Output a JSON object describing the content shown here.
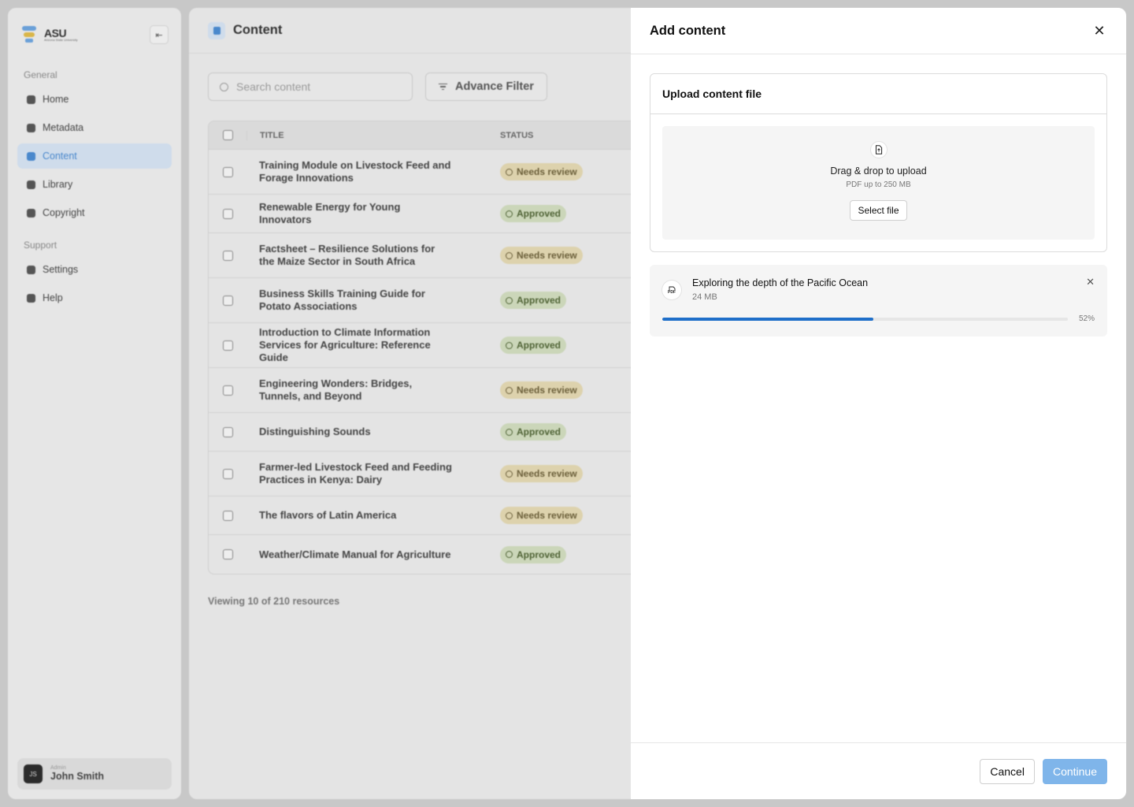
{
  "sidebar": {
    "logo_text": "ASU",
    "logo_subtext": "Arizona State University",
    "sections": [
      {
        "heading": "General",
        "items": [
          {
            "label": "Home",
            "icon": "home-icon"
          },
          {
            "label": "Metadata",
            "icon": "tag-icon"
          },
          {
            "label": "Content",
            "icon": "content-icon",
            "active": true
          },
          {
            "label": "Library",
            "icon": "library-icon"
          },
          {
            "label": "Copyright",
            "icon": "copyright-icon"
          }
        ]
      },
      {
        "heading": "Support",
        "items": [
          {
            "label": "Settings",
            "icon": "gear-icon"
          },
          {
            "label": "Help",
            "icon": "help-icon"
          }
        ]
      }
    ],
    "user": {
      "initials": "JS",
      "role": "Admin",
      "name": "John Smith"
    }
  },
  "main": {
    "title": "Content",
    "search_placeholder": "Search content",
    "filter_label": "Advance Filter",
    "columns": {
      "title": "TITLE",
      "status": "STATUS"
    },
    "rows": [
      {
        "title": "Training Module on Livestock Feed and Forage Innovations",
        "status": "Needs review"
      },
      {
        "title": "Renewable Energy for Young Innovators",
        "status": "Approved"
      },
      {
        "title": "Factsheet – Resilience Solutions for the Maize Sector in South Africa",
        "status": "Needs review"
      },
      {
        "title": "Business Skills Training Guide for Potato Associations",
        "status": "Approved"
      },
      {
        "title": "Introduction to Climate Information Services for Agriculture: Reference Guide",
        "status": "Approved"
      },
      {
        "title": "Engineering Wonders: Bridges, Tunnels, and Beyond",
        "status": "Needs review"
      },
      {
        "title": "Distinguishing Sounds",
        "status": "Approved"
      },
      {
        "title": "Farmer-led Livestock Feed and Feeding Practices in Kenya: Dairy",
        "status": "Needs review"
      },
      {
        "title": "The flavors of Latin America",
        "status": "Needs review"
      },
      {
        "title": "Weather/Climate Manual for Agriculture",
        "status": "Approved"
      }
    ],
    "viewing_text": "Viewing 10 of 210 resources"
  },
  "modal": {
    "title": "Add content",
    "upload_heading": "Upload content file",
    "drop_title": "Drag & drop to upload",
    "drop_subtitle": "PDF up to 250 MB",
    "select_file_label": "Select file",
    "file": {
      "type_label": "PDF",
      "name": "Exploring the depth of the Pacific Ocean",
      "size": "24 MB",
      "progress": 52,
      "progress_label": "52%"
    },
    "cancel_label": "Cancel",
    "continue_label": "Continue"
  },
  "colors": {
    "accent": "#1f6fc9",
    "continue_disabled": "#7fb5ea",
    "needs_review_bg": "#ddd2ad",
    "approved_bg": "#cbd6b9"
  }
}
